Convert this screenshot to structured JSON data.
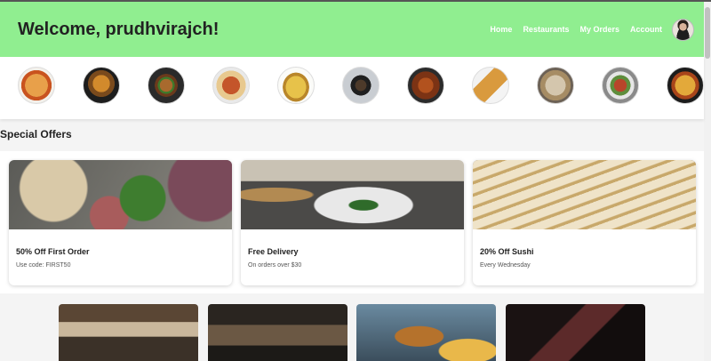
{
  "header": {
    "welcome": "Welcome, prudhvirajch!",
    "nav": [
      "Home",
      "Restaurants",
      "My Orders",
      "Account"
    ],
    "bg_color": "#90ee90"
  },
  "categories": [
    "pizza",
    "biryani",
    "burger",
    "chicken-rice",
    "taco",
    "noodle-bowl",
    "fried-chicken",
    "dosa",
    "shawarma",
    "salad-bowl",
    "pasta"
  ],
  "special_offers": {
    "title": "Special Offers",
    "offers": [
      {
        "title": "50% Off First Order",
        "subtitle": "Use code: FIRST50"
      },
      {
        "title": "Free Delivery",
        "subtitle": "On orders over $30"
      },
      {
        "title": "20% Off Sushi",
        "subtitle": "Every Wednesday"
      }
    ]
  },
  "restaurants": [
    "restaurant-interior",
    "cafe-patio",
    "burger-and-fries",
    "dark-bar"
  ]
}
